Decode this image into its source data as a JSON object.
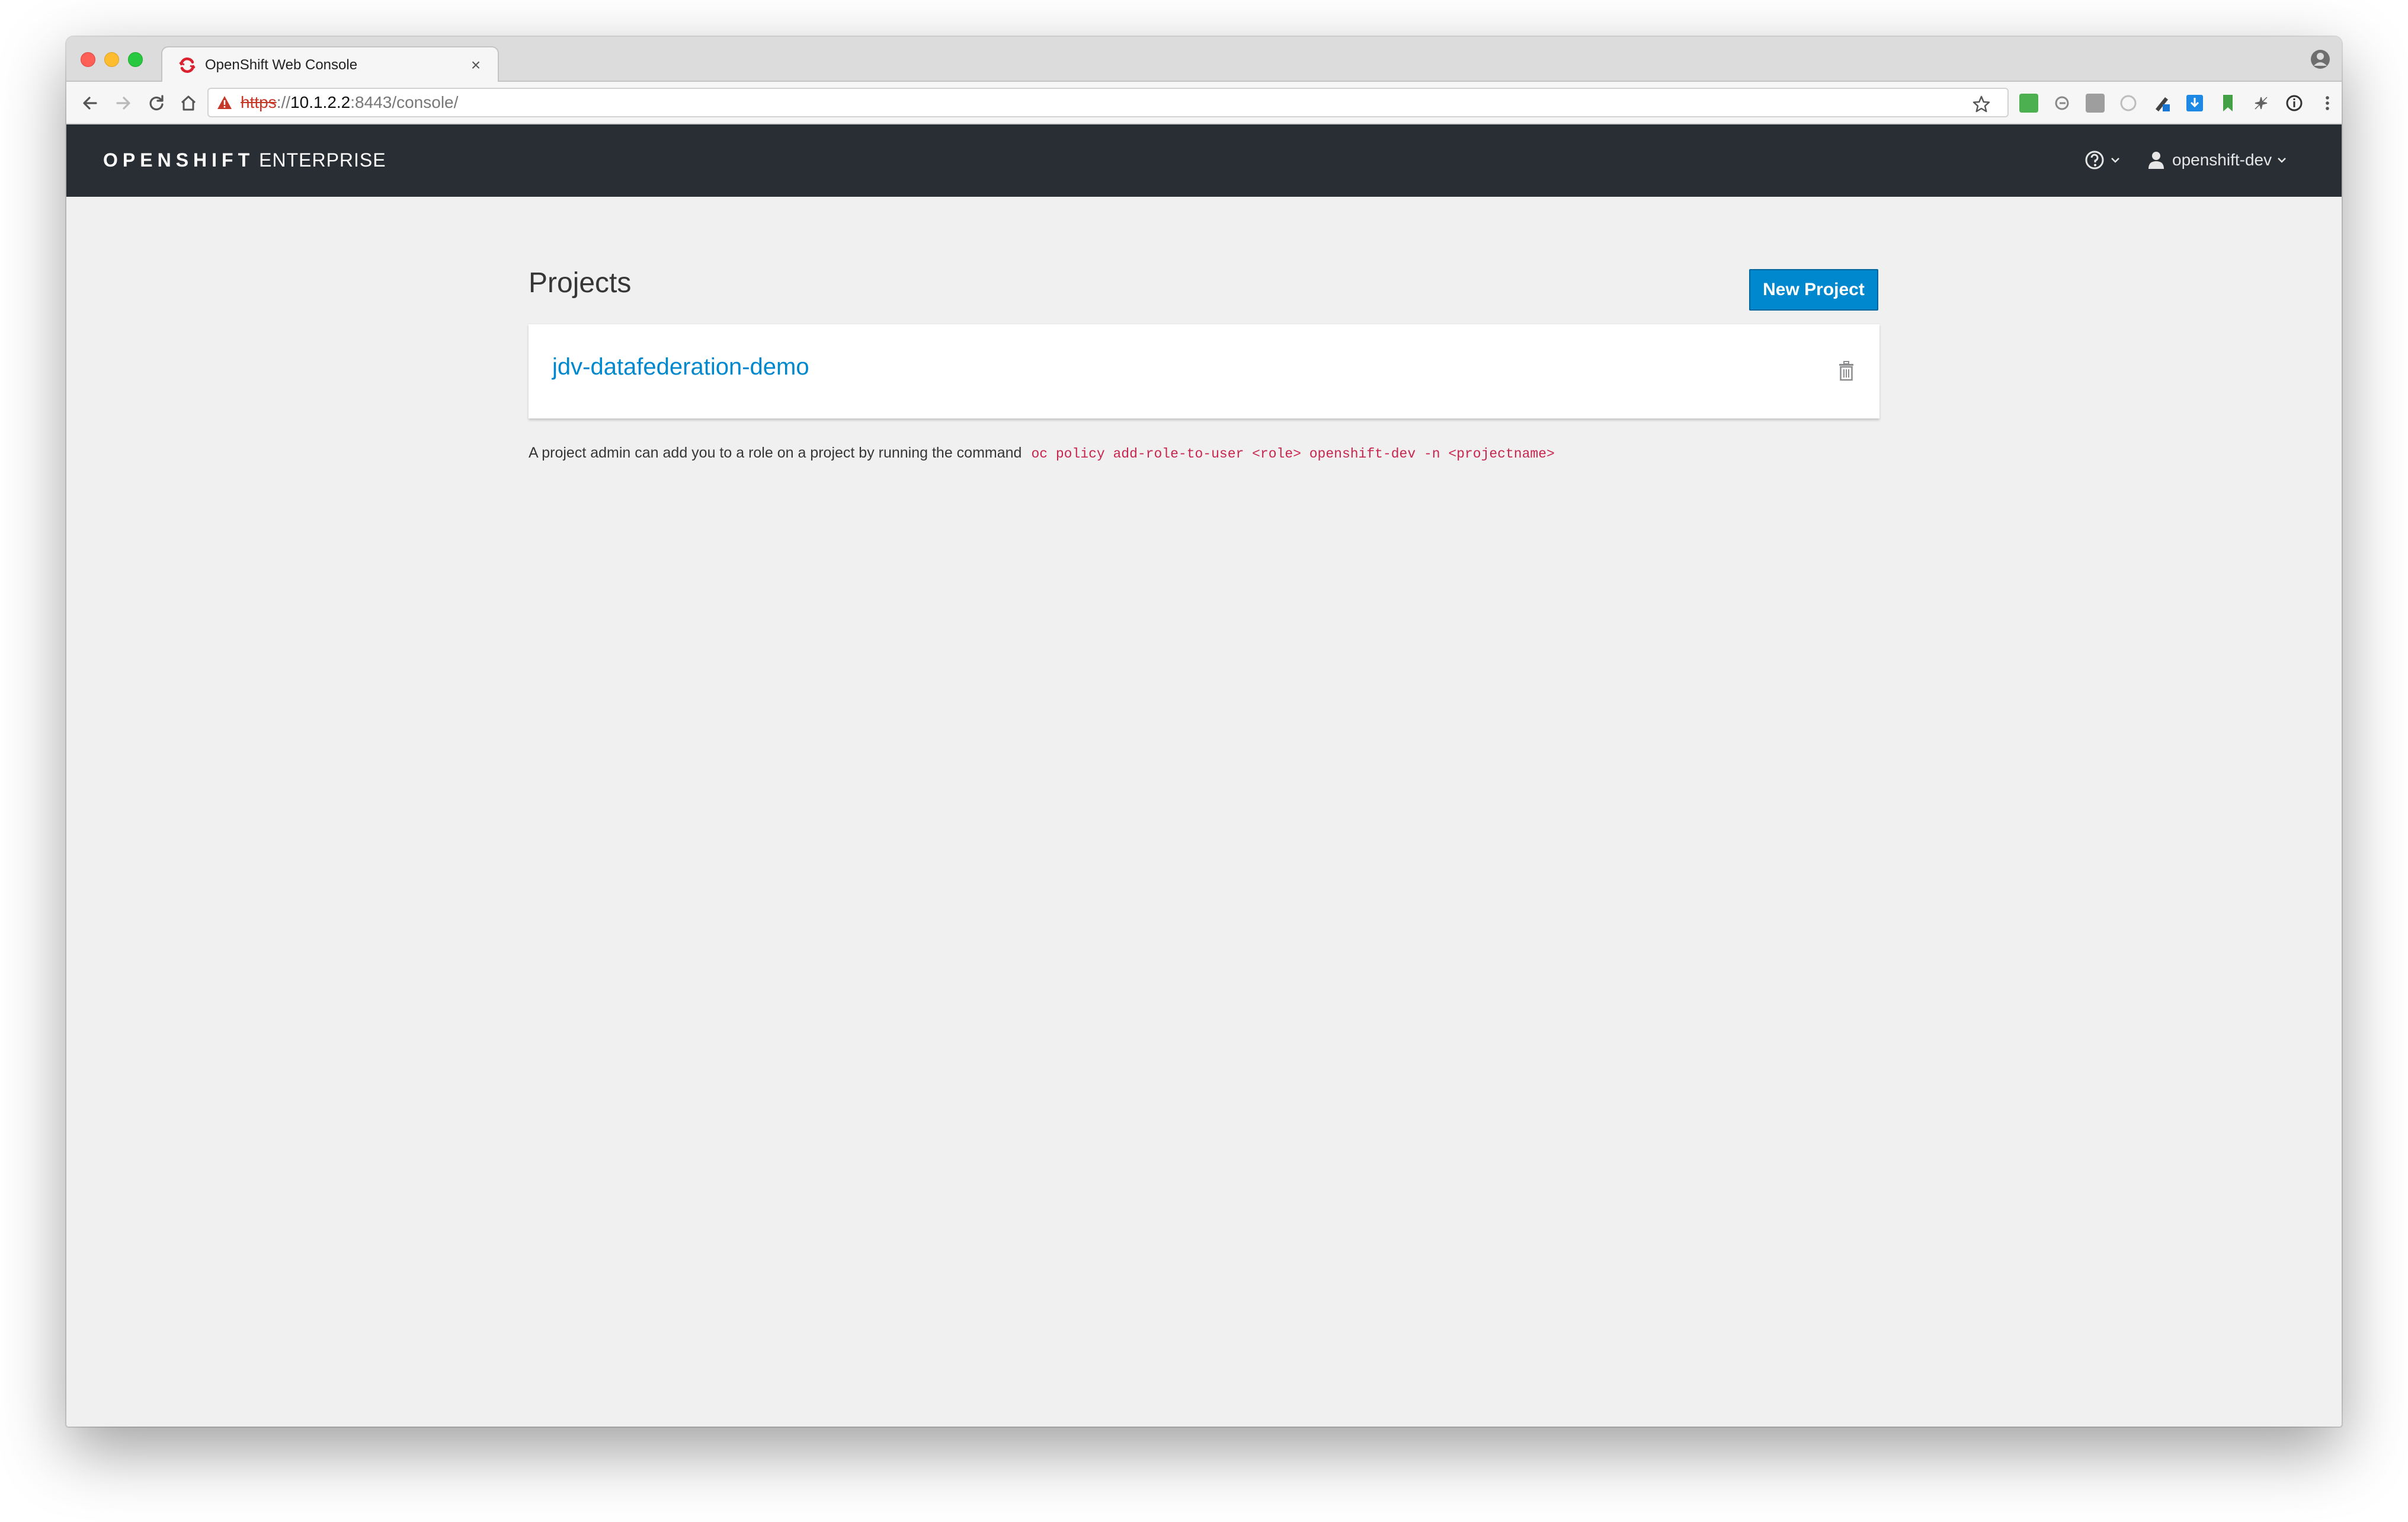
{
  "browser": {
    "tab_title": "OpenShift Web Console",
    "tab_close": "×",
    "url": {
      "scheme": "https",
      "separator": "://",
      "host": "10.1.2.2",
      "rest": ":8443/console/"
    },
    "extension_icons": [
      "ext-green-icon",
      "ext-circle-arrow-icon",
      "ext-gray-square-icon",
      "ext-ring-icon",
      "ext-pen-icon",
      "ext-download-icon",
      "ext-green-bookmark-icon",
      "ext-puzzle-icon",
      "ext-info-icon",
      "more-menu-icon"
    ]
  },
  "app": {
    "brand_strong": "OPENSHIFT",
    "brand_light": "ENTERPRISE",
    "user_name": "openshift-dev"
  },
  "projects": {
    "title": "Projects",
    "new_button_label": "New Project",
    "items": [
      {
        "name": "jdv-datafederation-demo"
      }
    ],
    "help_text": "A project admin can add you to a role on a project by running the command",
    "command": "oc policy add-role-to-user <role> openshift-dev -n <projectname>"
  },
  "colors": {
    "navbar_bg": "#292e34",
    "accent": "#0088ce",
    "code": "#c7254e",
    "page_bg": "#f1f0f0"
  }
}
